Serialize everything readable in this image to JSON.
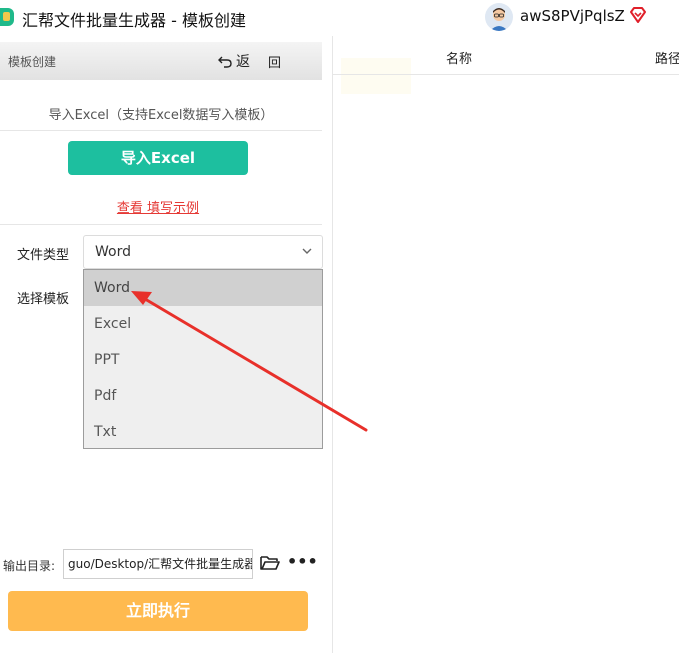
{
  "titlebar": {
    "app_title": "汇帮文件批量生成器 - 模板创建",
    "username": "awS8PVjPqlsZ",
    "app_icon": "app-logo-icon",
    "vip_icon": "vip-diamond-icon",
    "vip_color": "#e0202a"
  },
  "panel": {
    "header_title": "模板创建",
    "back_label": "返",
    "back_extra": "回",
    "import_hint": "导入Excel（支持Excel数据写入模板）",
    "import_button": "导入Excel",
    "example_link": "查看 填写示例",
    "file_type_label": "文件类型",
    "file_type_value": "Word",
    "template_label": "选择模板",
    "dropdown_options": [
      "Word",
      "Excel",
      "PPT",
      "Pdf",
      "Txt"
    ],
    "output_label": "输出目录:",
    "output_path": "guo/Desktop/汇帮文件批量生成器",
    "more_label": "•••",
    "run_button": "立即执行",
    "accent_color": "#1dbf9f",
    "run_color": "#ffba4f",
    "link_color": "#e53935"
  },
  "table": {
    "col_name": "名称",
    "col_path": "路径"
  },
  "annotation": {
    "arrow_color": "#e8302a"
  }
}
